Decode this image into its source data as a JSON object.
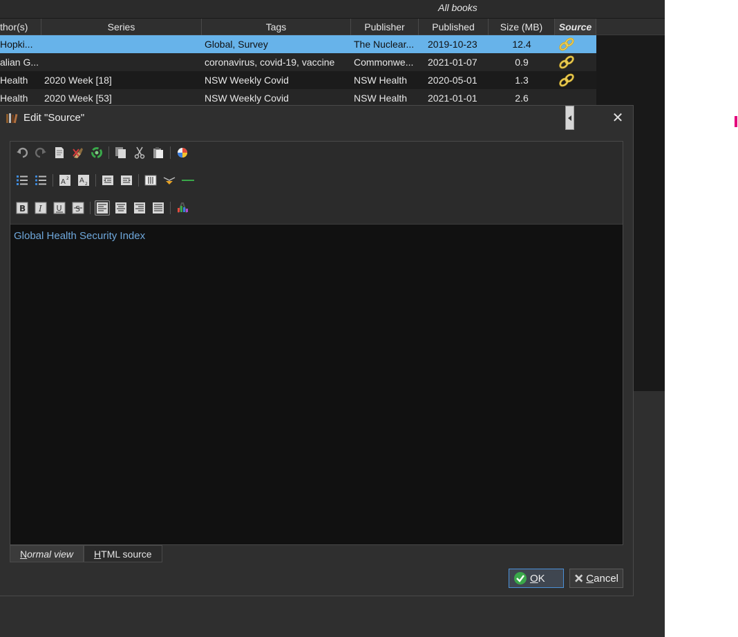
{
  "library": {
    "view_label": "All books",
    "columns": [
      "thor(s)",
      "Series",
      "Tags",
      "Publisher",
      "Published",
      "Size (MB)",
      "Source"
    ],
    "rows": [
      {
        "authors": "Hopki...",
        "series": "",
        "tags": "Global, Survey",
        "publisher": "The Nuclear...",
        "published": "2019-10-23",
        "size": "12.4",
        "has_source": true
      },
      {
        "authors": "alian G...",
        "series": "",
        "tags": "coronavirus, covid-19, vaccine",
        "publisher": "Commonwe...",
        "published": "2021-01-07",
        "size": "0.9",
        "has_source": true
      },
      {
        "authors": " Health",
        "series": "2020 Week [18]",
        "tags": "NSW Weekly Covid",
        "publisher": "NSW Health",
        "published": "2020-05-01",
        "size": "1.3",
        "has_source": true
      },
      {
        "authors": " Health",
        "series": "2020 Week [53]",
        "tags": "NSW Weekly Covid",
        "publisher": "NSW Health",
        "published": "2021-01-01",
        "size": "2.6",
        "has_source": false
      }
    ]
  },
  "dialog": {
    "title": "Edit \"Source\"",
    "close_glyph": "✕",
    "content_text": "Global Health Security Index",
    "tabs": {
      "normal_rest": "ormal view",
      "normal_key": "N",
      "html_rest": "TML source",
      "html_key": "H"
    },
    "ok_rest": "K",
    "ok_key": "O",
    "cancel_rest": "ancel",
    "cancel_key": "C"
  },
  "colors": {
    "selected_row": "#67b3ea",
    "link_text": "#6fa8dc",
    "accent_magenta": "#e4007c"
  },
  "toolbar_icons": {
    "row1": [
      "undo-icon",
      "redo-icon",
      "clear-icon",
      "remove-format-icon",
      "refresh-icon",
      "copy-icon",
      "cut-icon",
      "paste-icon",
      "background-color-icon"
    ],
    "row2": [
      "ordered-list-icon",
      "unordered-list-icon",
      "superscript-icon",
      "subscript-icon",
      "outdent-icon",
      "indent-icon",
      "insert-table-icon",
      "insert-link-icon",
      "horizontal-rule-icon"
    ],
    "row3": [
      "bold-icon",
      "italic-icon",
      "underline-icon",
      "strikethrough-icon",
      "align-left-icon",
      "align-center-icon",
      "align-right-icon",
      "justify-icon",
      "text-color-icon"
    ]
  }
}
